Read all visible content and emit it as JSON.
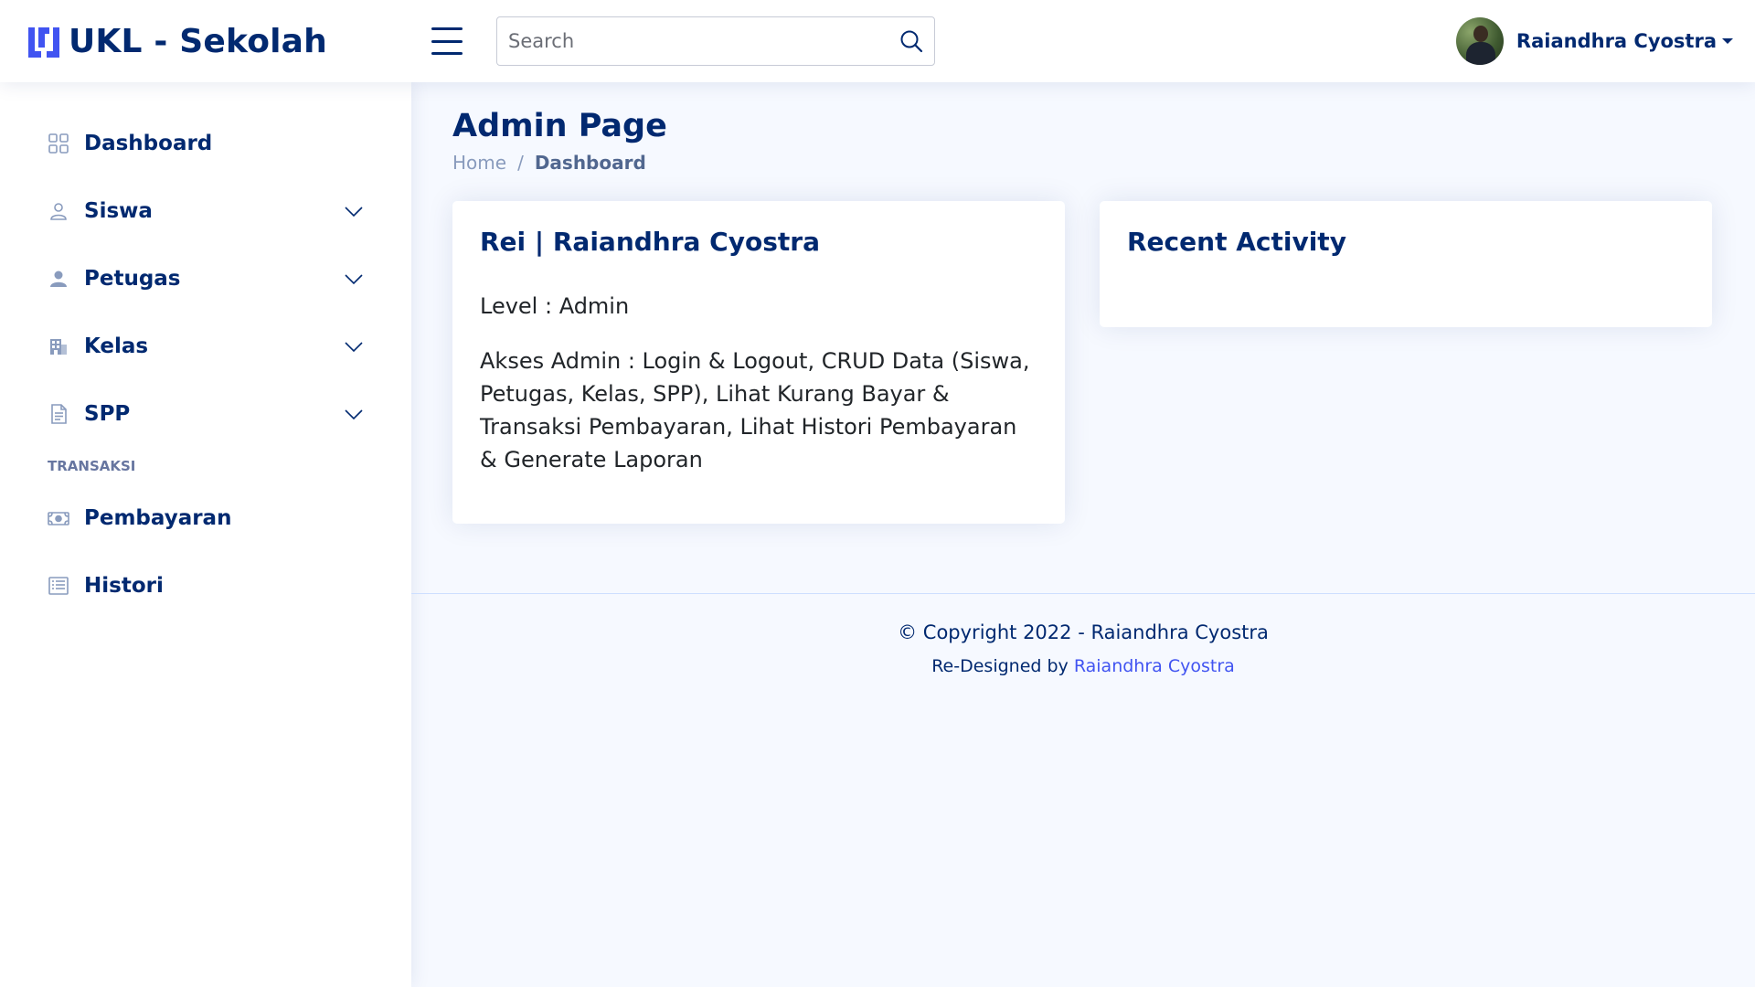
{
  "header": {
    "logo_text": "UKL - Sekolah",
    "search_placeholder": "Search",
    "profile_name": "Raiandhra Cyostra"
  },
  "sidebar": {
    "items": [
      {
        "label": "Dashboard",
        "icon": "grid-icon",
        "has_submenu": false
      },
      {
        "label": "Siswa",
        "icon": "person-outline-icon",
        "has_submenu": true
      },
      {
        "label": "Petugas",
        "icon": "person-fill-icon",
        "has_submenu": true
      },
      {
        "label": "Kelas",
        "icon": "building-icon",
        "has_submenu": true
      },
      {
        "label": "SPP",
        "icon": "file-text-icon",
        "has_submenu": true
      }
    ],
    "heading": "TRANSAKSI",
    "transaksi_items": [
      {
        "label": "Pembayaran",
        "icon": "cash-icon"
      },
      {
        "label": "Histori",
        "icon": "list-icon"
      }
    ]
  },
  "main": {
    "page_title": "Admin Page",
    "breadcrumb": {
      "home": "Home",
      "separator": "/",
      "current": "Dashboard"
    },
    "profile_card": {
      "title": "Rei | Raiandhra Cyostra",
      "level": "Level : Admin",
      "access": "Akses Admin : Login & Logout, CRUD Data (Siswa, Petugas, Kelas, SPP), Lihat Kurang Bayar & Transaksi Pembayaran, Lihat Histori Pembayaran & Generate Laporan"
    },
    "activity_card": {
      "title": "Recent Activity"
    }
  },
  "footer": {
    "copyright": "© Copyright 2022 - Raiandhra Cyostra",
    "credits_prefix": "Re-Designed by",
    "credits_link": "Raiandhra Cyostra"
  },
  "colors": {
    "brand": "#012970",
    "accent": "#4154f1",
    "background": "#f6f9ff",
    "muted": "#899bbd"
  }
}
